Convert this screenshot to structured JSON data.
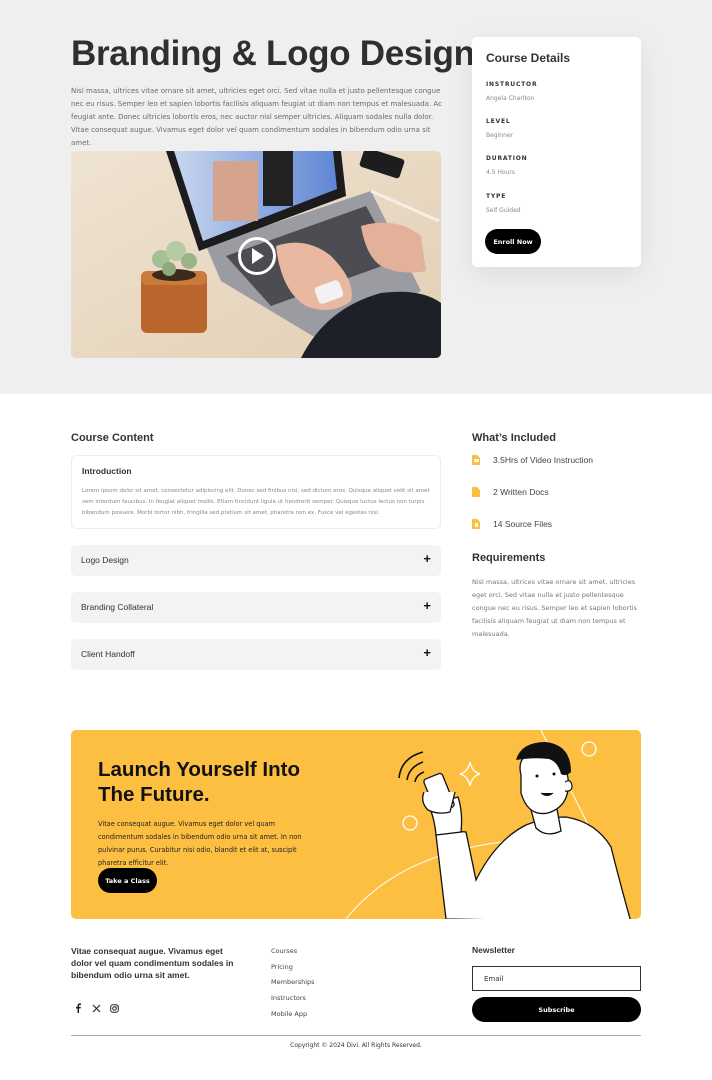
{
  "hero": {
    "title": "Branding & Logo Design",
    "description": "Nisl massa, ultrices vitae ornare sit amet, ultricies eget orci. Sed vitae nulla et justo pellentesque congue nec eu risus. Semper leo et sapien lobortis facilisis aliquam feugiat ut diam non tempus et malesuada. Ac feugiat ante. Donec ultricies lobortis eros, nec auctor nisl semper ultricies. Aliquam sodales nulla dolor. Vitae consequat augue. Vivamus eget dolor vel quam condimentum sodales in bibendum odio urna sit amet.",
    "media": {
      "type": "video",
      "play_icon": "play-circle-icon"
    }
  },
  "course_details": {
    "title": "Course Details",
    "items": [
      {
        "label": "INSTRUCTOR",
        "value": "Angela Charlton"
      },
      {
        "label": "LEVEL",
        "value": "Beginner"
      },
      {
        "label": "DURATION",
        "value": "4.5 Hours"
      },
      {
        "label": "TYPE",
        "value": "Self Guided"
      }
    ],
    "enroll_label": "Enroll Now"
  },
  "course_content": {
    "title": "Course Content",
    "intro": {
      "title": "Introduction",
      "text": "Lorem ipsum dolor sit amet, consectetur adipiscing elit. Donec sed finibus nisi, sed dictum eros. Quisque aliquet velit sit amet sem interdum faucibus. In feugiat aliquet mollis. Etiam tincidunt ligula ut hendrerit semper. Quisque luctus lectus non turpis bibendum posuere. Morbi tortor nibh, fringilla sed pretium sit amet, pharetra non ex. Fusce vel egestas nisl."
    },
    "modules": [
      {
        "label": "Logo Design",
        "icon": "plus-icon",
        "toggle": "+"
      },
      {
        "label": "Branding Collateral",
        "icon": "plus-icon",
        "toggle": "+"
      },
      {
        "label": "Client Handoff",
        "icon": "plus-icon",
        "toggle": "+"
      }
    ]
  },
  "included": {
    "title": "What’s Included",
    "items": [
      {
        "label": "3.5Hrs of Video Instruction",
        "icon": "video-file-icon"
      },
      {
        "label": "2 Written Docs",
        "icon": "document-icon"
      },
      {
        "label": "14 Source Files",
        "icon": "download-file-icon"
      }
    ]
  },
  "requirements": {
    "title": "Requirements",
    "text": "Nisl massa, ultrices vitae ornare sit amet, ultricies eget orci. Sed vitae nulla et justo pellentesque congue nec eu risus. Semper leo et sapien lobortis facilisis aliquam feugiat ut diam non tempus et malesuada."
  },
  "cta": {
    "title": "Launch Yourself Into The Future.",
    "description": "Vitae consequat augue. Vivamus eget dolor vel quam condimentum sodales in bibendum odio urna sit amet. In non pulvinar purus. Curabitur nisi odio, blandit et elit at, suscipit pharetra efficitur elit.",
    "button_label": "Take a Class",
    "accent_color": "#fdbf42"
  },
  "footer": {
    "blurb": "Vitae consequat augue. Vivamus eget dolor vel quam condimentum sodales in bibendum odio urna sit amet.",
    "social": [
      {
        "name": "facebook-icon",
        "glyph": "f"
      },
      {
        "name": "x-twitter-icon",
        "glyph": "𝕏"
      },
      {
        "name": "instagram-icon",
        "glyph": "◎"
      }
    ],
    "links": [
      "Courses",
      "Pricing",
      "Memberships",
      "Instructors",
      "Mobile App"
    ],
    "newsletter": {
      "title": "Newsletter",
      "email_placeholder": "Email",
      "subscribe_label": "Subscribe"
    },
    "copyright": "Copyright © 2024 Divi. All Rights Reserved."
  }
}
